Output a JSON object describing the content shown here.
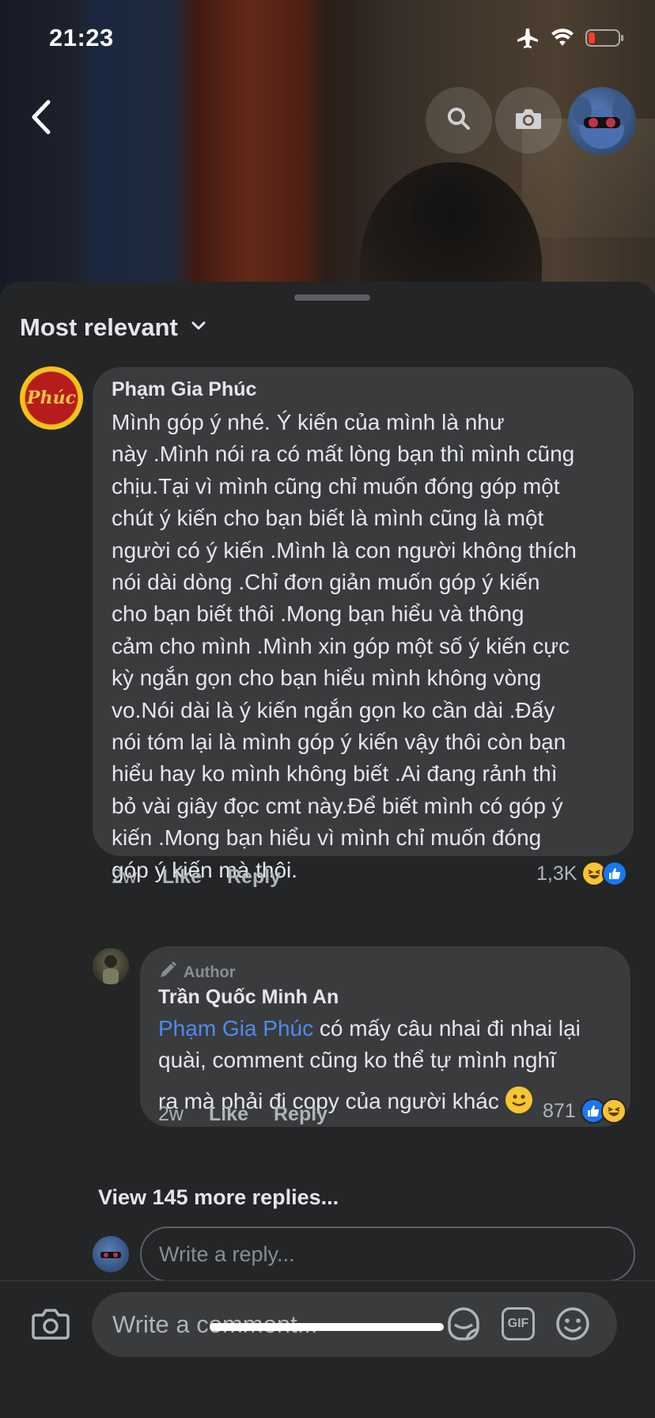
{
  "status_bar": {
    "time": "21:23"
  },
  "media_nav": {
    "back_icon": "chevron-left-icon",
    "search_icon": "search-icon",
    "camera_icon": "camera-icon"
  },
  "sheet": {
    "sort_label": "Most relevant"
  },
  "comments": [
    {
      "author": "Phạm Gia Phúc",
      "avatar_text": "Phúc",
      "lines": [
        "Mình góp ý nhé. Ý kiến của mình là như",
        "này .Mình nói ra có mất lòng bạn thì mình cũng",
        "chịu.Tại vì mình cũng chỉ muốn đóng góp một",
        "chút ý kiến cho bạn biết là mình cũng là một",
        "người có ý kiến .Mình là con người không thích",
        "nói dài dòng .Chỉ đơn giản muốn góp ý kiến",
        "cho bạn biết thôi .Mong bạn hiểu và thông",
        "cảm cho mình .Mình xin góp một số ý kiến cực",
        "kỳ ngắn gọn cho bạn hiểu mình không vòng",
        "vo.Nói dài là ý kiến ngắn gọn ko cần dài .Đấy",
        "nói tóm lại là mình góp ý kiến vậy thôi còn bạn",
        "hiểu hay ko mình không biết .Ai đang rảnh thì",
        "bỏ vài giây đọc cmt này.Để biết mình có góp ý",
        "kiến .Mong bạn hiểu vì mình chỉ muốn đóng",
        "góp ý kiến mà thôi."
      ],
      "time": "2w",
      "like_label": "Like",
      "reply_label": "Reply",
      "reaction_count": "1,3K"
    }
  ],
  "reply": {
    "tag": "Author",
    "author": "Trần Quốc Minh An",
    "mention": "Phạm Gia Phúc",
    "line1_rest": " có mấy câu nhai đi nhai lại",
    "line2": "quài,  comment cũng ko thể tự mình nghĩ",
    "line3": "ra mà phải đi  copy của người khác ",
    "time": "2w",
    "like_label": "Like",
    "reply_label": "Reply",
    "reaction_count": "871"
  },
  "view_more": "View 145 more replies...",
  "reply_input": {
    "placeholder": "Write a reply..."
  },
  "composer": {
    "placeholder": "Write a comment...",
    "gif_label": "GIF"
  },
  "colors": {
    "background": "#242526",
    "bubble": "#3a3b3c",
    "mention": "#4c8bf5",
    "like_blue": "#1877f2",
    "haha_yellow": "#f7c433"
  }
}
